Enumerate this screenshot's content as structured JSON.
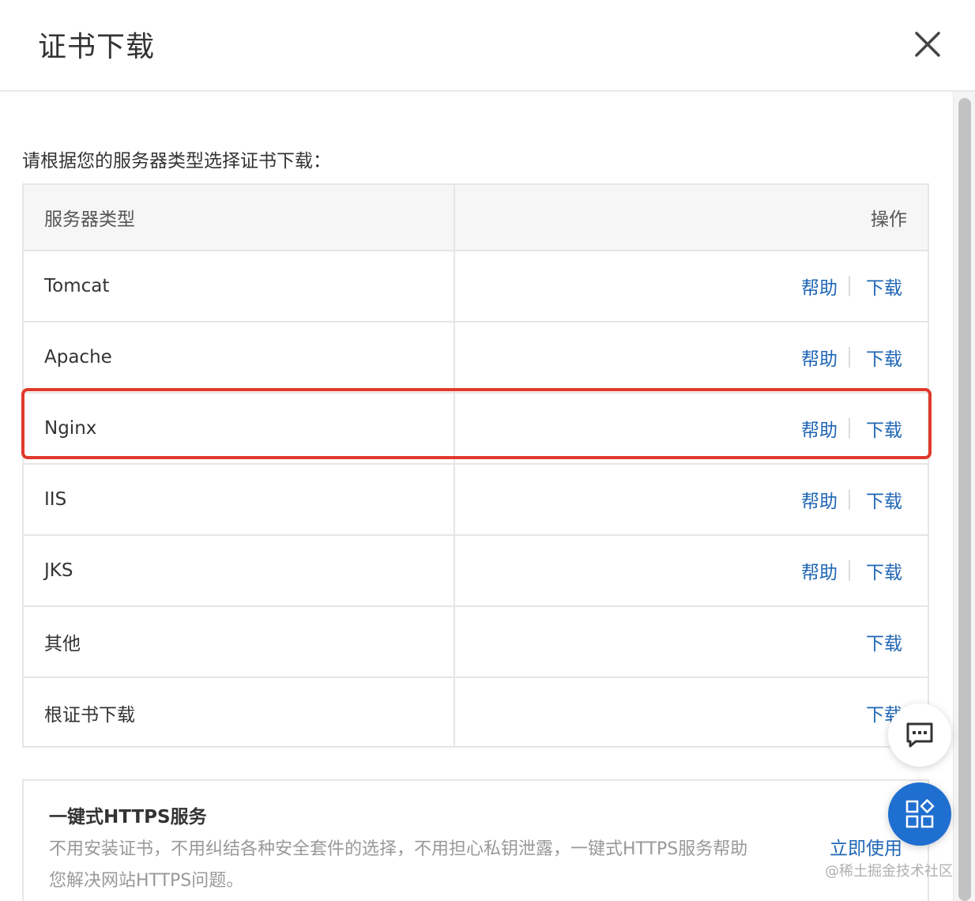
{
  "dialog": {
    "title": "证书下载"
  },
  "intro": "请根据您的服务器类型选择证书下载：",
  "table": {
    "headers": {
      "server_type": "服务器类型",
      "action": "操作"
    },
    "rows": [
      {
        "name": "Tomcat",
        "help": "帮助",
        "download": "下载"
      },
      {
        "name": "Apache",
        "help": "帮助",
        "download": "下载"
      },
      {
        "name": "Nginx",
        "help": "帮助",
        "download": "下载",
        "highlighted": true
      },
      {
        "name": "IIS",
        "help": "帮助",
        "download": "下载"
      },
      {
        "name": "JKS",
        "help": "帮助",
        "download": "下载"
      },
      {
        "name": "其他",
        "help": null,
        "download": "下载"
      },
      {
        "name": "根证书下载",
        "help": null,
        "download": "下载"
      }
    ]
  },
  "promo": {
    "title": "一键式HTTPS服务",
    "line1": "不用安装证书，不用纠结各种安全套件的选择，不用担心私钥泄露，一键式HTTPS服务帮助",
    "line2": "您解决网站HTTPS问题。",
    "link": "立即使用"
  },
  "icons": {
    "close": "close-icon",
    "chat": "chat-bubble-icon",
    "apps": "apps-grid-icon"
  },
  "colors": {
    "link": "#1f66b5",
    "highlight_border": "#e0392b",
    "apps_button": "#1f6fd1"
  },
  "watermark": "@稀土掘金技术社区"
}
